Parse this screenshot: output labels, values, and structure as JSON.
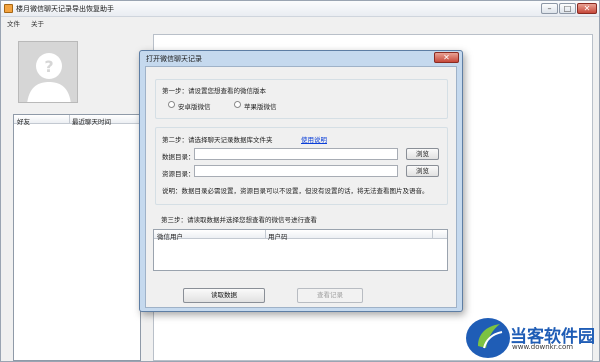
{
  "main_window": {
    "title": "楼月微信聊天记录导出恢复助手",
    "menu": [
      "文件",
      "关于"
    ],
    "friend_list": {
      "columns": [
        "好友",
        "最近聊天时间"
      ]
    }
  },
  "dialog": {
    "title": "打开微信聊天记录",
    "step1": {
      "title": "第一步：请设置您想查看的微信版本",
      "options": [
        "安卓版微信",
        "苹果版微信"
      ],
      "selected": ""
    },
    "step2": {
      "title": "第二步：请选择聊天记录数据库文件夹",
      "help_link": "使用说明",
      "data_dir_label": "数据目录：",
      "data_dir_value": "",
      "res_dir_label": "资源目录：",
      "res_dir_value": "",
      "browse_label": "浏览",
      "note": "说明：数据目录必需设置，资源目录可以不设置，但没有设置的话，将无法查看图片及语音。"
    },
    "step3": {
      "title": "第三步：请读取数据并选择您想查看的微信号进行查看",
      "columns": [
        "微信用户",
        "用户码"
      ]
    },
    "buttons": {
      "read": "读取数据",
      "view": "查看记录"
    }
  },
  "watermark": {
    "text": "当客软件园",
    "url": "www.downkr.com"
  },
  "colors": {
    "dialog_frame": "#c5d9ee",
    "link": "#0b3fd8",
    "close_button": "#c6483a",
    "brand_blue": "#1f5db6",
    "brand_green": "#7cc242"
  }
}
